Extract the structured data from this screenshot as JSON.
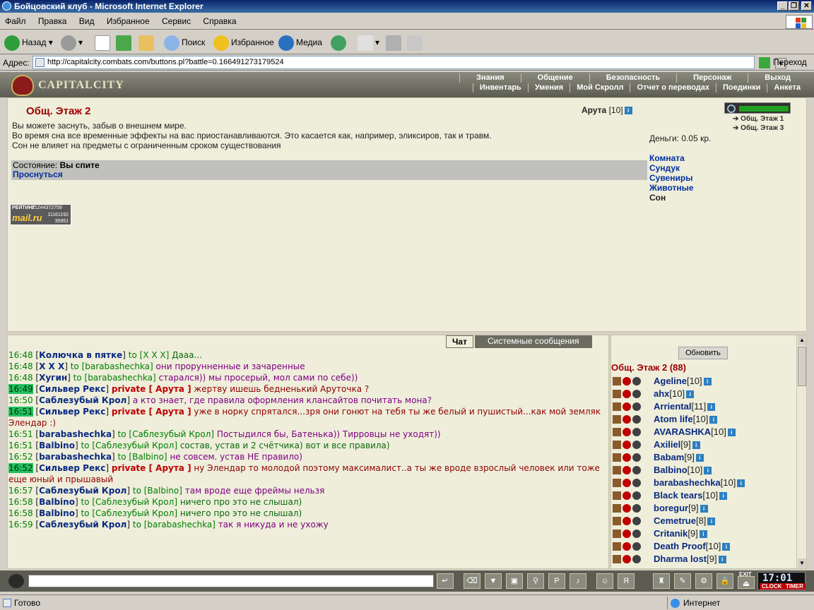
{
  "window": {
    "title": "Бойцовский клуб - Microsoft Internet Explorer",
    "minimize": "_",
    "restore": "❐",
    "close": "✕"
  },
  "menu": [
    "Файл",
    "Правка",
    "Вид",
    "Избранное",
    "Сервис",
    "Справка"
  ],
  "toolbar": {
    "back": "Назад",
    "search": "Поиск",
    "favorites": "Избранное",
    "media": "Медиа"
  },
  "address": {
    "label": "Адрес:",
    "url": "http://capitalcity.combats.com/buttons.pl?battle=0.166491273179524",
    "go": "Переход"
  },
  "game": {
    "logo": "CAPITALCITY",
    "nav_top": [
      "Знания",
      "Общение",
      "Безопасность",
      "Персонаж",
      "Выход"
    ],
    "nav_bottom": [
      "Инвентарь",
      "Умения",
      "Мой Скролл",
      "Отчет о переводах",
      "Поединки",
      "Анкета"
    ]
  },
  "room": {
    "title": "Общ. Этаж 2",
    "text_lines": [
      "Вы можете заснуть, забыв о внешнем мире.",
      "Во время сна все временные эффекты на вас приостанавливаются. Это касается как, например, эликсиров, так и травм.",
      "Сон не влияет на предметы с ограниченным сроком существования"
    ],
    "state_label": "Состояние:",
    "state_value": "Вы спите",
    "wake": "Проснуться",
    "user": "Арута",
    "user_level": "[10]",
    "rating": {
      "label": "РЕЙТИНГ",
      "brand": "mail.ru",
      "n1": "21244372759",
      "n2": "11161192",
      "n3": "35951"
    }
  },
  "side": {
    "floor1": "Общ. Этаж 1",
    "floor3": "Общ. Этаж 3",
    "money": "Деньги: 0.05 кр.",
    "links": [
      "Комната",
      "Сундук",
      "Сувениры",
      "Животные",
      "Сон"
    ]
  },
  "chat": {
    "tab_chat": "Чат",
    "tab_system": "Системные сообщения",
    "lines": [
      {
        "t": "16:48",
        "hl": false,
        "from": "Колючка в пятке",
        "kind": "to",
        "target": "X X X",
        "msg": "Дааа...",
        "color": "m-dgreen"
      },
      {
        "t": "16:48",
        "hl": false,
        "from": "X X X",
        "kind": "to",
        "target": "barabashechka",
        "msg": "они прорунненные и зачаренные",
        "color": "m-purple"
      },
      {
        "t": "16:48",
        "hl": false,
        "from": "Хугин",
        "kind": "to",
        "target": "barabashechka",
        "msg": "старался)) мы просерый, мол сами по себе))",
        "color": "m-purple"
      },
      {
        "t": "16:49",
        "hl": true,
        "from": "Сильвер Рекс",
        "kind": "private",
        "target": "Арута",
        "msg": "жертву ишешь бедненький Аруточка ?",
        "color": "m-red"
      },
      {
        "t": "16:50",
        "hl": false,
        "from": "Саблезубый Крол",
        "kind": "to",
        "target": "",
        "msg": "а кто знает, где правила оформления клансайтов почитать мона?",
        "color": "m-purple"
      },
      {
        "t": "16:51",
        "hl": true,
        "from": "Сильвер Рекс",
        "kind": "private",
        "target": "Арута",
        "msg": "уже в норку спрятался...зря они гонют на тебя ты же белый и пушистый...как мой земляк Элендар :)",
        "color": "m-red"
      },
      {
        "t": "16:51",
        "hl": false,
        "from": "barabashechka",
        "kind": "to",
        "target": "Саблезубый Крол",
        "msg": "Постыдился бы, Батенька)) Тирровцы не уходят))",
        "color": "m-purple"
      },
      {
        "t": "16:51",
        "hl": false,
        "from": "Balbino",
        "kind": "to",
        "target": "Саблезубый Крол",
        "msg": "состав, устав и 2 счётчика) вот и все правила)",
        "color": "m-dgreen"
      },
      {
        "t": "16:52",
        "hl": false,
        "from": "barabashechka",
        "kind": "to",
        "target": "Balbino",
        "msg": "не совсем. устав НЕ правило)",
        "color": "m-purple"
      },
      {
        "t": "16:52",
        "hl": true,
        "from": "Сильвер Рекс",
        "kind": "private",
        "target": "Арута",
        "msg": "ну Элендар то молодой поэтому максималист..а ты же вроде взрослый человек или тоже еще юный и прышавый",
        "color": "m-red"
      },
      {
        "t": "16:57",
        "hl": false,
        "from": "Саблезубый Крол",
        "kind": "to",
        "target": "Balbino",
        "msg": "там вроде еще фреймы нельзя",
        "color": "m-purple"
      },
      {
        "t": "16:58",
        "hl": false,
        "from": "Balbino",
        "kind": "to",
        "target": "Саблезубый Крол",
        "msg": "ничего про это не слышал)",
        "color": "m-dgreen"
      },
      {
        "t": "16:58",
        "hl": false,
        "from": "Balbino",
        "kind": "to",
        "target": "Саблезубый Крол",
        "msg": "ничего про это не слышал)",
        "color": "m-dgreen"
      },
      {
        "t": "16:59",
        "hl": false,
        "from": "Саблезубый Крол",
        "kind": "to",
        "target": "barabashechka",
        "msg": "так я никуда и не ухожу",
        "color": "m-purple"
      }
    ]
  },
  "users_panel": {
    "refresh": "Обновить",
    "header": "Общ. Этаж 2 (88)",
    "users": [
      {
        "name": "Ageline",
        "lvl": "[10]"
      },
      {
        "name": "ahx",
        "lvl": "[10]"
      },
      {
        "name": "Arriental",
        "lvl": "[11]"
      },
      {
        "name": "Atom life",
        "lvl": "[10]"
      },
      {
        "name": "AVARASHKA",
        "lvl": "[10]"
      },
      {
        "name": "Axiliel",
        "lvl": "[9]"
      },
      {
        "name": "Babam",
        "lvl": "[9]"
      },
      {
        "name": "Balbino",
        "lvl": "[10]"
      },
      {
        "name": "barabashechka",
        "lvl": "[10]"
      },
      {
        "name": "Black tears",
        "lvl": "[10]"
      },
      {
        "name": "boregur",
        "lvl": "[9]"
      },
      {
        "name": "Cemetrue",
        "lvl": "[8]"
      },
      {
        "name": "Critanik",
        "lvl": "[9]"
      },
      {
        "name": "Death Proof",
        "lvl": "[10]"
      },
      {
        "name": "Dharma lost",
        "lvl": "[9]"
      }
    ]
  },
  "bottom": {
    "clock_time": "17:01",
    "clock_label": "CLOCK",
    "timer_label": "TIMER",
    "exit_label": "EXIT"
  },
  "status": {
    "text": "Готово",
    "zone": "Интернет"
  }
}
